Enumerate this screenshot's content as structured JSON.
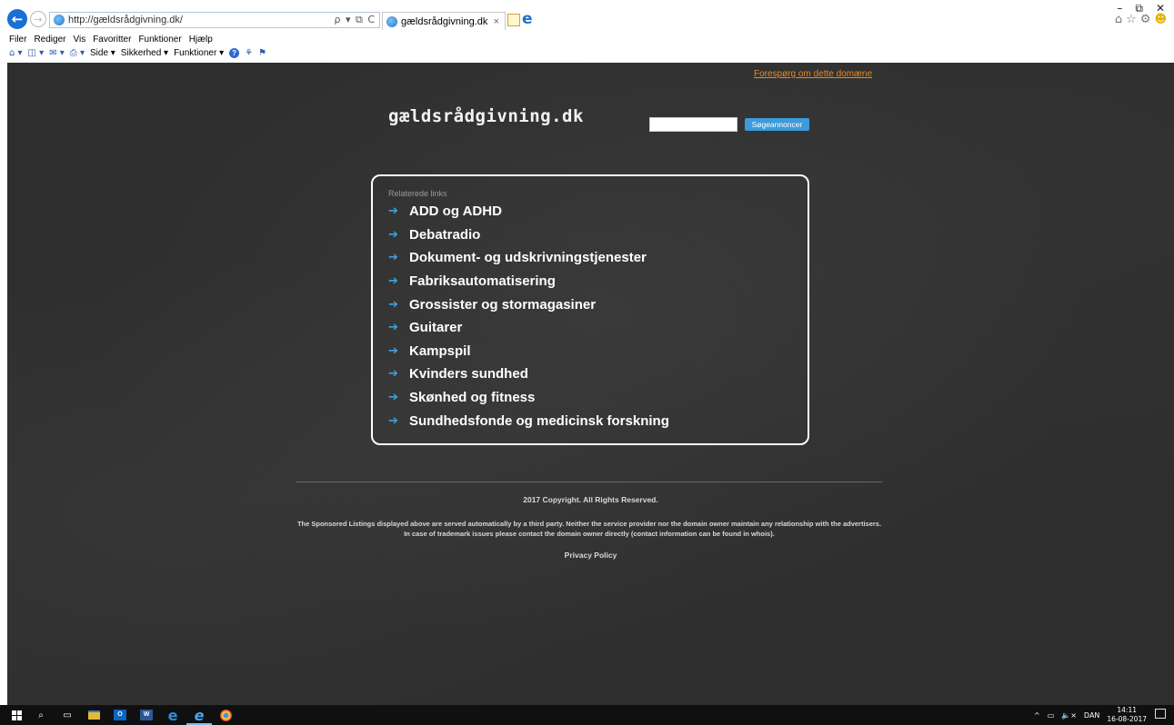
{
  "browser": {
    "address_url": "http://gældsrådgivning.dk/",
    "address_tools": "ρ ▾ ⧉ C",
    "tab_title": "gældsrådgivning.dk",
    "tab_close": "×",
    "window_controls": {
      "minimize": "–",
      "restore": "⧉",
      "close": "✕"
    },
    "right_tools": {
      "home": "⌂",
      "favorites": "☆",
      "settings": "⚙",
      "feedback": "☻"
    },
    "menu": [
      "Filer",
      "Rediger",
      "Vis",
      "Favoritter",
      "Funktioner",
      "Hjælp"
    ],
    "commandbar": {
      "page_label": "Side ▾",
      "safety_label": "Sikkerhed ▾",
      "tools_label": "Funktioner ▾"
    }
  },
  "page": {
    "inquiry_link": "Forespørg om dette domæne",
    "site_title": "gældsrådgivning.dk",
    "search": {
      "value": "",
      "button_label": "Søgeannoncer"
    },
    "links_heading": "Relaterede links",
    "links": [
      {
        "label": "ADD og ADHD"
      },
      {
        "label": "Debatradio"
      },
      {
        "label": "Dokument- og udskrivningstjenester"
      },
      {
        "label": "Fabriksautomatisering"
      },
      {
        "label": "Grossister og stormagasiner"
      },
      {
        "label": "Guitarer"
      },
      {
        "label": "Kampspil"
      },
      {
        "label": "Kvinders sundhed"
      },
      {
        "label": "Skønhed og fitness"
      },
      {
        "label": "Sundhedsfonde og medicinsk forskning"
      }
    ],
    "link_arrow": "➔",
    "copyright": "2017 Copyright. All Rights Reserved.",
    "disclaimer": "The Sponsored Listings displayed above are served automatically by a third party. Neither the service provider nor the domain owner maintain any relationship with the advertisers. In case of trademark issues please contact the domain owner directly (contact information can be found in whois).",
    "privacy_link": "Privacy Policy"
  },
  "taskbar": {
    "tray": {
      "chevron": "^",
      "language": "DAN",
      "time": "14:11",
      "date": "16-08-2017"
    }
  },
  "colors": {
    "accent_arrow": "#3ca3e0",
    "search_button": "#3d9bd9",
    "inquiry_link": "#f08a1c",
    "background": "#2e2e2e"
  }
}
